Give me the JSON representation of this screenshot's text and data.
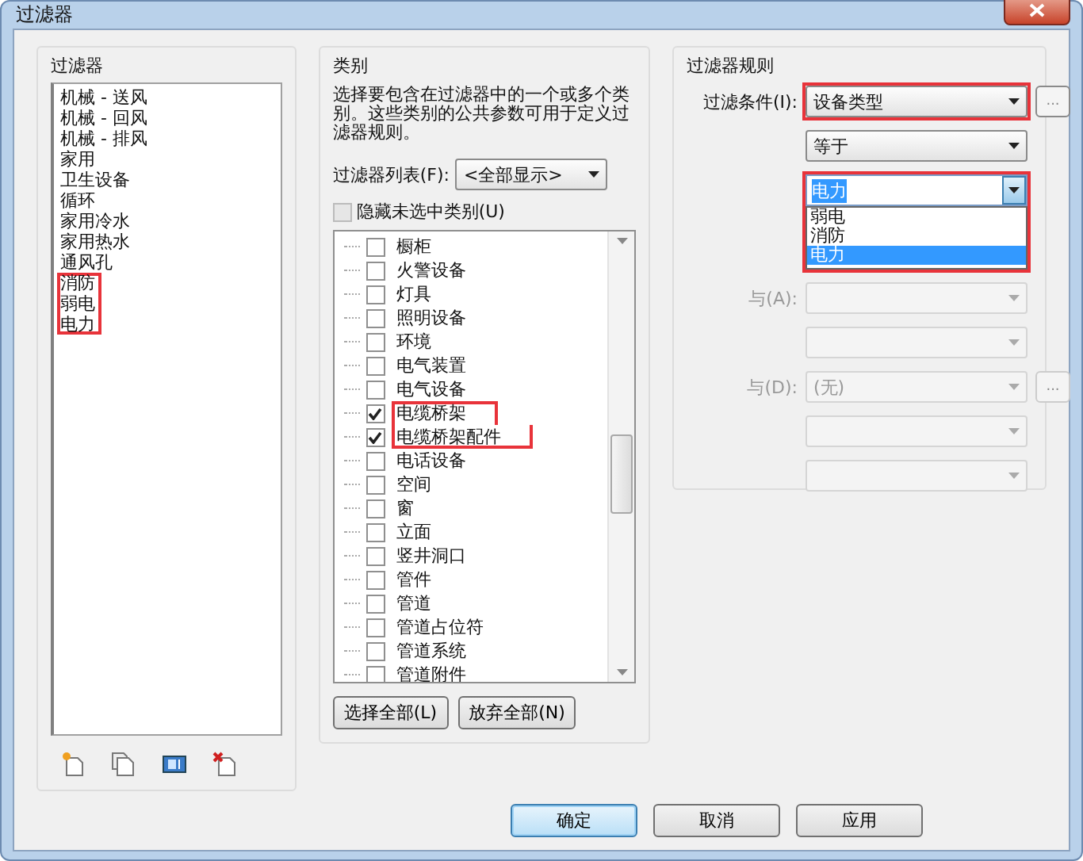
{
  "window": {
    "title": "过滤器"
  },
  "filters": {
    "title": "过滤器",
    "items": [
      {
        "label": "机械 - 送风",
        "highlighted": false
      },
      {
        "label": "机械 - 回风",
        "highlighted": false
      },
      {
        "label": "机械 - 排风",
        "highlighted": false
      },
      {
        "label": "家用",
        "highlighted": false
      },
      {
        "label": "卫生设备",
        "highlighted": false
      },
      {
        "label": "循环",
        "highlighted": false
      },
      {
        "label": "家用冷水",
        "highlighted": false
      },
      {
        "label": "家用热水",
        "highlighted": false
      },
      {
        "label": "通风孔",
        "highlighted": false
      },
      {
        "label": "消防",
        "highlighted": true
      },
      {
        "label": "弱电",
        "highlighted": true
      },
      {
        "label": "电力",
        "highlighted": true
      }
    ],
    "tools": [
      {
        "kind": "new"
      },
      {
        "kind": "duplicate"
      },
      {
        "kind": "rename"
      },
      {
        "kind": "delete"
      }
    ]
  },
  "categories": {
    "title": "类别",
    "description": "选择要包含在过滤器中的一个或多个类别。这些类别的公共参数可用于定义过滤器规则。",
    "list_label": "过滤器列表(F):",
    "list_value": "<全部显示>",
    "hide_unchecked": {
      "label": "隐藏未选中类别(U)",
      "checked": false
    },
    "items": [
      {
        "label": "橱柜",
        "checked": false,
        "highlighted": false
      },
      {
        "label": "火警设备",
        "checked": false,
        "highlighted": false
      },
      {
        "label": "灯具",
        "checked": false,
        "highlighted": false
      },
      {
        "label": "照明设备",
        "checked": false,
        "highlighted": false
      },
      {
        "label": "环境",
        "checked": false,
        "highlighted": false
      },
      {
        "label": "电气装置",
        "checked": false,
        "highlighted": false
      },
      {
        "label": "电气设备",
        "checked": false,
        "highlighted": false
      },
      {
        "label": "电缆桥架",
        "checked": true,
        "highlighted": true
      },
      {
        "label": "电缆桥架配件",
        "checked": true,
        "highlighted": true
      },
      {
        "label": "电话设备",
        "checked": false,
        "highlighted": false
      },
      {
        "label": "空间",
        "checked": false,
        "highlighted": false
      },
      {
        "label": "窗",
        "checked": false,
        "highlighted": false
      },
      {
        "label": "立面",
        "checked": false,
        "highlighted": false
      },
      {
        "label": "竖井洞口",
        "checked": false,
        "highlighted": false
      },
      {
        "label": "管件",
        "checked": false,
        "highlighted": false
      },
      {
        "label": "管道",
        "checked": false,
        "highlighted": false
      },
      {
        "label": "管道占位符",
        "checked": false,
        "highlighted": false
      },
      {
        "label": "管道系统",
        "checked": false,
        "highlighted": false
      },
      {
        "label": "管道附件",
        "checked": false,
        "highlighted": false
      }
    ],
    "buttons": [
      "选择全部(L)",
      "放弃全部(N)"
    ]
  },
  "rules": {
    "title": "过滤器规则",
    "rows": [
      {
        "kind": "select",
        "label": "过滤条件(I):",
        "value": "设备类型",
        "disabled": false,
        "more": "...",
        "highlighted": true
      },
      {
        "kind": "select",
        "value": "等于",
        "disabled": false,
        "highlighted": false
      },
      {
        "kind": "combo",
        "value": "电力",
        "highlighted": true,
        "options": [
          {
            "label": "弱电",
            "selected": false
          },
          {
            "label": "消防",
            "selected": false
          },
          {
            "label": "电力",
            "selected": true
          }
        ]
      },
      {
        "kind": "select",
        "label": "与(A):",
        "disabled": true,
        "highlighted": false
      },
      {
        "kind": "select",
        "disabled": true,
        "highlighted": false
      },
      {
        "kind": "select",
        "label": "与(D):",
        "value": "(无)",
        "disabled": true,
        "more": "...",
        "highlighted": false
      },
      {
        "kind": "select",
        "disabled": true,
        "highlighted": false
      },
      {
        "kind": "select",
        "disabled": true,
        "highlighted": false
      }
    ]
  },
  "buttons": [
    {
      "label": "确定",
      "default": true
    },
    {
      "label": "取消",
      "default": false
    },
    {
      "label": "应用",
      "default": false
    }
  ]
}
